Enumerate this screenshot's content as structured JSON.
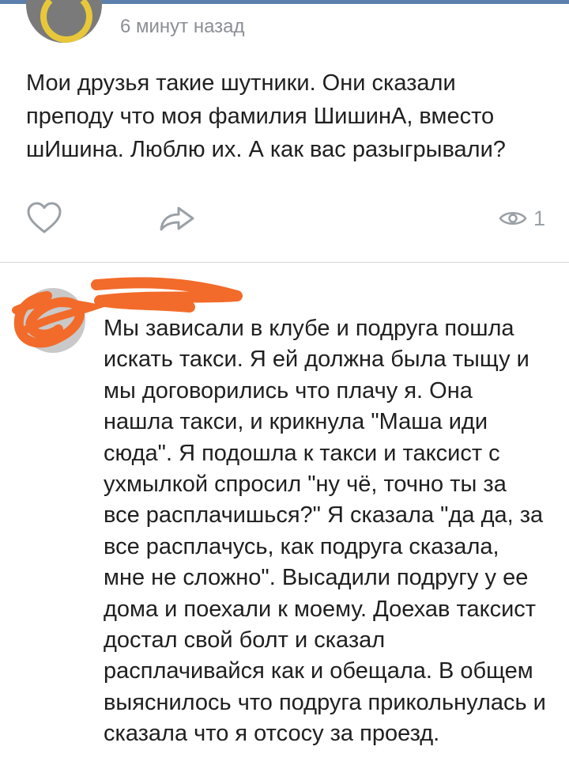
{
  "post": {
    "time": "6 минут назад",
    "text": "Мои друзья такие шутники. Они сказали преподу что моя фамилия ШишинА, вместо шИшина. Люблю их. А как вас разыгрывали?",
    "views": "1"
  },
  "comment": {
    "text": "Мы зависали в клубе и подруга пошла искать такси. Я ей должна была тыщу и мы договорились что плачу я. Она нашла такси, и крикнула \"Маша иди сюда\". Я подошла к такси и таксист с ухмылкой спросил \"ну чё, точно ты за все расплачишься?\" Я сказала \"да да, за все расплачусь, как подруга сказала, мне не сложно\". Высадили подругу у ее дома и поехали к моему. Доехав таксист достал свой болт и сказал расплачивайся как и обещала. В общем выяснилось что подруга прикольнулась и сказала что я отсосу за проезд."
  },
  "icons": {
    "like": "heart-icon",
    "share": "share-arrow-icon",
    "views": "eye-icon"
  },
  "colors": {
    "scribble": "#f26b2a",
    "meta_text": "#8a8f96",
    "icon": "#9aa0a6",
    "accent": "#5b80ad"
  }
}
